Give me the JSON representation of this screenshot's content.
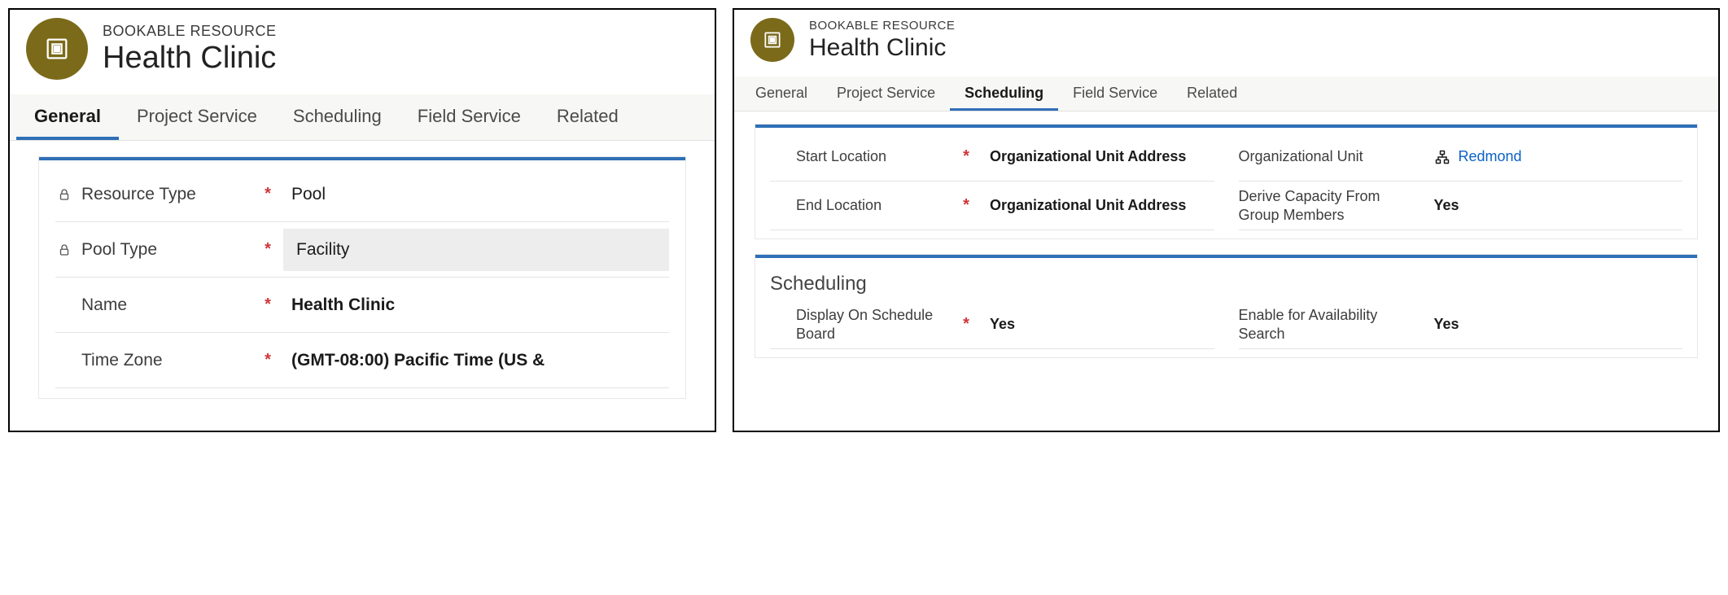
{
  "left": {
    "entity": "BOOKABLE RESOURCE",
    "title": "Health Clinic",
    "tabs": [
      {
        "key": "general",
        "label": "General",
        "active": true
      },
      {
        "key": "project_service",
        "label": "Project Service",
        "active": false
      },
      {
        "key": "scheduling",
        "label": "Scheduling",
        "active": false
      },
      {
        "key": "field_service",
        "label": "Field Service",
        "active": false
      },
      {
        "key": "related",
        "label": "Related",
        "active": false
      }
    ],
    "fields": {
      "resource_type": {
        "label": "Resource Type",
        "value": "Pool",
        "locked": true,
        "required": true
      },
      "pool_type": {
        "label": "Pool Type",
        "value": "Facility",
        "locked": true,
        "required": true
      },
      "name": {
        "label": "Name",
        "value": "Health Clinic",
        "locked": false,
        "required": true
      },
      "time_zone": {
        "label": "Time Zone",
        "value": "(GMT-08:00) Pacific Time (US &",
        "locked": false,
        "required": true
      }
    }
  },
  "right": {
    "entity": "BOOKABLE RESOURCE",
    "title": "Health Clinic",
    "tabs": [
      {
        "key": "general",
        "label": "General",
        "active": false
      },
      {
        "key": "project_service",
        "label": "Project Service",
        "active": false
      },
      {
        "key": "scheduling",
        "label": "Scheduling",
        "active": true
      },
      {
        "key": "field_service",
        "label": "Field Service",
        "active": false
      },
      {
        "key": "related",
        "label": "Related",
        "active": false
      }
    ],
    "section1": {
      "start_location": {
        "label": "Start Location",
        "value": "Organizational Unit Address",
        "required": true
      },
      "end_location": {
        "label": "End Location",
        "value": "Organizational Unit Address",
        "required": true
      },
      "org_unit": {
        "label": "Organizational Unit",
        "value": "Redmond"
      },
      "derive_capacity": {
        "label": "Derive Capacity From Group Members",
        "value": "Yes"
      }
    },
    "section2": {
      "title": "Scheduling",
      "display_on_board": {
        "label": "Display On Schedule Board",
        "value": "Yes",
        "required": true
      },
      "enable_availability": {
        "label": "Enable for Availability Search",
        "value": "Yes"
      }
    }
  }
}
